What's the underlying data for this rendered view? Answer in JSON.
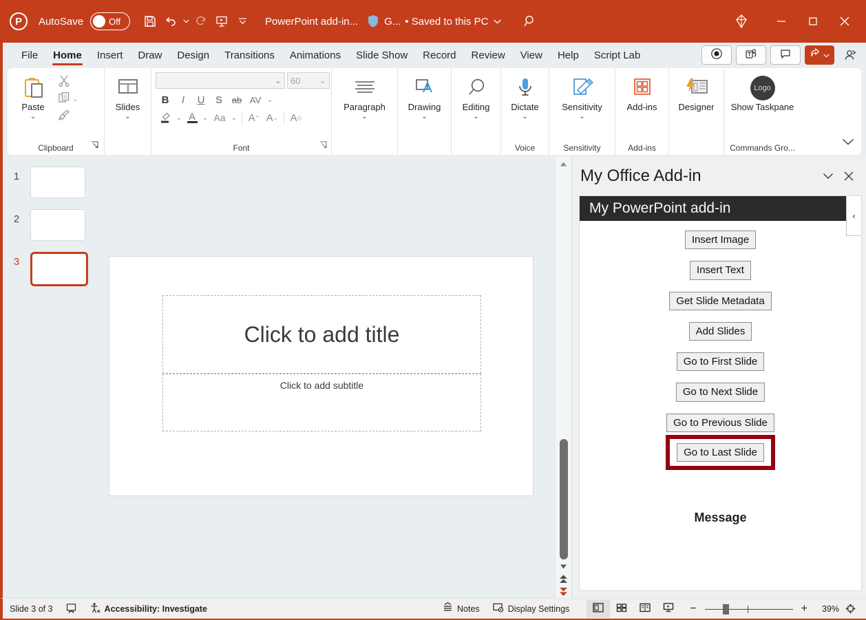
{
  "titlebar": {
    "app_logo": "powerpoint-logo",
    "autosave_label": "AutoSave",
    "autosave_state": "Off",
    "quick_access": [
      {
        "name": "save-icon",
        "tooltip": "Save"
      },
      {
        "name": "undo-icon",
        "tooltip": "Undo"
      },
      {
        "name": "redo-icon",
        "tooltip": "Redo"
      },
      {
        "name": "start-from-beginning-icon",
        "tooltip": "Start From Beginning"
      },
      {
        "name": "customize-quick-access-toolbar-icon",
        "tooltip": "Customize Quick Access Toolbar"
      }
    ],
    "document_title": "PowerPoint add-in...",
    "account_initial": "G...",
    "saved_state": "• Saved to this PC",
    "search_icon": "search-icon",
    "copilot_icon": "copilot-icon",
    "minimize": "minimize-icon",
    "maximize": "maximize-icon",
    "close": "close-icon"
  },
  "ribbon": {
    "tabs": [
      {
        "label": "File",
        "active": false
      },
      {
        "label": "Home",
        "active": true
      },
      {
        "label": "Insert",
        "active": false
      },
      {
        "label": "Draw",
        "active": false
      },
      {
        "label": "Design",
        "active": false
      },
      {
        "label": "Transitions",
        "active": false
      },
      {
        "label": "Animations",
        "active": false
      },
      {
        "label": "Slide Show",
        "active": false
      },
      {
        "label": "Record",
        "active": false
      },
      {
        "label": "Review",
        "active": false
      },
      {
        "label": "View",
        "active": false
      },
      {
        "label": "Help",
        "active": false
      },
      {
        "label": "Script Lab",
        "active": false
      }
    ],
    "right_commands": [
      {
        "name": "record-button",
        "icon": "record-circle-icon"
      },
      {
        "name": "present-in-teams-button",
        "icon": "teams-icon"
      },
      {
        "name": "comments-button",
        "icon": "comment-icon"
      },
      {
        "name": "share-button",
        "icon": "share-icon"
      },
      {
        "name": "people-button",
        "icon": "person-add-icon"
      }
    ],
    "groups": [
      {
        "label": "Clipboard",
        "has_dialog_launcher": true,
        "buttons": [
          {
            "label": "Paste",
            "icon": "paste-icon",
            "has_chevron": true
          },
          {
            "label": "",
            "icon": "cut-scissors-icon"
          },
          {
            "label": "",
            "icon": "copy-icon",
            "has_chevron": true
          },
          {
            "label": "",
            "icon": "format-painter-icon"
          }
        ]
      },
      {
        "label": "",
        "buttons": [
          {
            "label": "Slides",
            "icon": "slides-layout-icon",
            "has_chevron": true
          }
        ]
      },
      {
        "label": "Font",
        "has_dialog_launcher": true,
        "font_name": "",
        "font_name_placeholder": "",
        "font_size": "60",
        "format_buttons": [
          {
            "name": "bold-button",
            "glyph": "B"
          },
          {
            "name": "italic-button",
            "glyph": "I"
          },
          {
            "name": "underline-button",
            "glyph": "U"
          },
          {
            "name": "text-shadow-button",
            "glyph": "S"
          },
          {
            "name": "strikethrough-button",
            "glyph": "ab"
          },
          {
            "name": "character-spacing-button",
            "glyph": "AV"
          }
        ],
        "format_buttons_row2": [
          {
            "name": "text-highlight-color-button",
            "glyph": "highlighter-icon"
          },
          {
            "name": "font-color-button",
            "glyph": "A"
          },
          {
            "name": "change-case-button",
            "glyph": "Aa"
          },
          {
            "name": "increase-font-size-button",
            "glyph": "A"
          },
          {
            "name": "decrease-font-size-button",
            "glyph": "A"
          },
          {
            "name": "clear-formatting-button",
            "glyph": "A"
          }
        ]
      },
      {
        "label": "",
        "buttons": [
          {
            "label": "Paragraph",
            "icon": "paragraph-lines-icon",
            "has_chevron": true
          }
        ]
      },
      {
        "label": "",
        "buttons": [
          {
            "label": "Drawing",
            "icon": "drawing-shape-icon",
            "has_chevron": true
          }
        ]
      },
      {
        "label": "",
        "buttons": [
          {
            "label": "Editing",
            "icon": "magnifier-icon",
            "has_chevron": true
          }
        ]
      },
      {
        "label": "Voice",
        "buttons": [
          {
            "label": "Dictate",
            "icon": "microphone-icon",
            "has_chevron": true
          }
        ]
      },
      {
        "label": "Sensitivity",
        "buttons": [
          {
            "label": "Sensitivity",
            "icon": "sensitivity-label-icon",
            "has_chevron": true
          }
        ]
      },
      {
        "label": "Add-ins",
        "buttons": [
          {
            "label": "Add-ins",
            "icon": "addins-grid-icon",
            "has_chevron": false
          }
        ]
      },
      {
        "label": "",
        "buttons": [
          {
            "label": "Designer",
            "icon": "designer-icon",
            "has_chevron": false
          }
        ]
      },
      {
        "label": "Commands Gro...",
        "buttons": [
          {
            "label": "Show Taskpane",
            "icon": "logo-circle-icon",
            "icon_text": "Logo",
            "has_chevron": false
          }
        ]
      }
    ],
    "collapse_ribbon_icon": "chevron-down-icon"
  },
  "slides_panel": {
    "thumbnails": [
      {
        "number": "1",
        "selected": false
      },
      {
        "number": "2",
        "selected": false
      },
      {
        "number": "3",
        "selected": true
      }
    ]
  },
  "slide_canvas": {
    "title_placeholder": "Click to add title",
    "subtitle_placeholder": "Click to add subtitle",
    "scroll": {
      "up_arrow": "scroll-up-icon",
      "down_arrow": "scroll-down-icon",
      "previous_slide": "previous-slide-double-arrow-icon",
      "next_slide": "next-slide-double-arrow-icon"
    }
  },
  "taskpane": {
    "title": "My Office Add-in",
    "chevron_icon": "chevron-down-icon",
    "close_icon": "close-icon",
    "banner_title": "My PowerPoint add-in",
    "collapse_icon": "chevron-left-icon",
    "buttons": [
      {
        "label": "Insert Image",
        "highlighted": false
      },
      {
        "label": "Insert Text",
        "highlighted": false
      },
      {
        "label": "Get Slide Metadata",
        "highlighted": false
      },
      {
        "label": "Add Slides",
        "highlighted": false
      },
      {
        "label": "Go to First Slide",
        "highlighted": false
      },
      {
        "label": "Go to Next Slide",
        "highlighted": false
      },
      {
        "label": "Go to Previous Slide",
        "highlighted": false
      },
      {
        "label": "Go to Last Slide",
        "highlighted": true
      }
    ],
    "message_heading": "Message",
    "highlight_color": "#96000f"
  },
  "statusbar": {
    "slide_indicator": "Slide 3 of 3",
    "notes_page_icon": "notes-page-icon",
    "accessibility_icon": "accessibility-icon",
    "accessibility_text": "Accessibility: Investigate",
    "notes_label": "Notes",
    "notes_icon": "notes-icon",
    "display_settings_label": "Display Settings",
    "display_settings_icon": "display-settings-icon",
    "views": [
      {
        "name": "normal-view-button",
        "icon": "normal-view-icon",
        "active": true
      },
      {
        "name": "slide-sorter-view-button",
        "icon": "slide-sorter-icon",
        "active": false
      },
      {
        "name": "reading-view-button",
        "icon": "reading-view-icon",
        "active": false
      },
      {
        "name": "slide-show-view-button",
        "icon": "slide-show-icon",
        "active": false
      }
    ],
    "zoom_out": "−",
    "zoom_in": "+",
    "zoom_level": "39%",
    "fit_to_window_icon": "fit-to-window-icon"
  },
  "colors": {
    "brand": "#c43e1c",
    "ribbon_bg": "#e9eef0",
    "banner_bg": "#2b2b2b",
    "highlight": "#96000f"
  }
}
